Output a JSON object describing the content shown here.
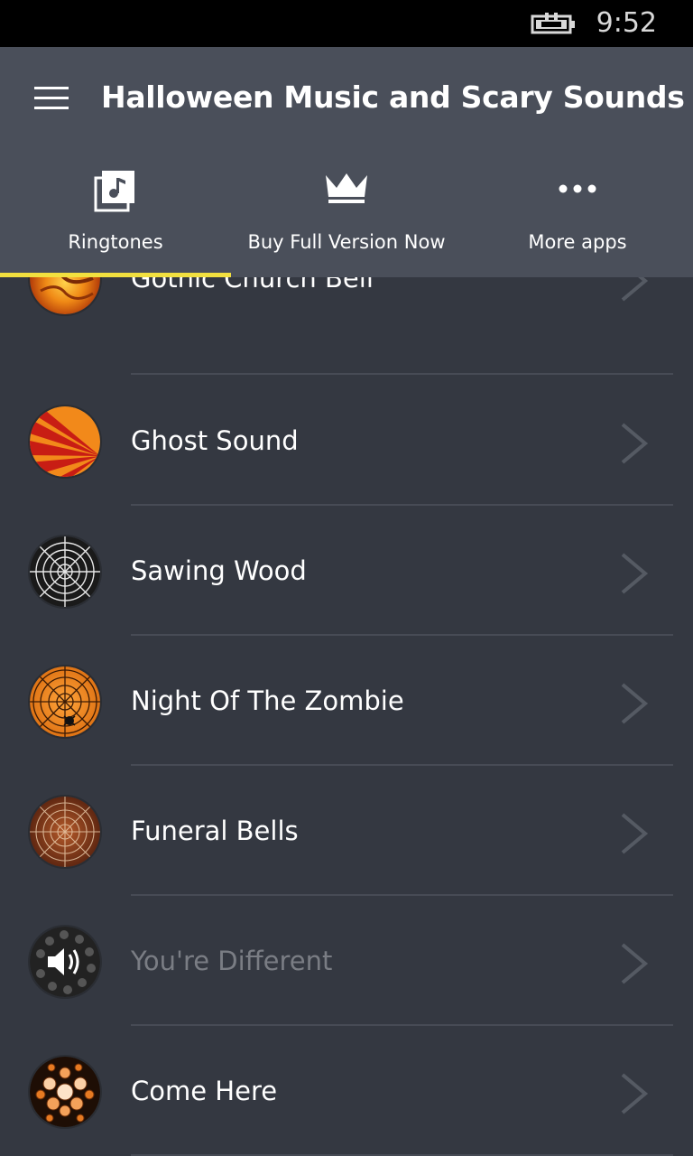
{
  "status": {
    "time": "9:52"
  },
  "header": {
    "title": "Halloween Music and Scary Sounds"
  },
  "tabs": [
    {
      "label": "Ringtones",
      "icon": "music-note-icon"
    },
    {
      "label": "Buy Full Version Now",
      "icon": "crown-icon"
    },
    {
      "label": "More apps",
      "icon": "more-dots-icon"
    }
  ],
  "items": [
    {
      "label": "Gothic Church Bell",
      "icon": "fire-orange-icon"
    },
    {
      "label": "Ghost Sound",
      "icon": "red-stripes-icon"
    },
    {
      "label": "Sawing Wood",
      "icon": "spider-web-grey-icon"
    },
    {
      "label": "Night Of The Zombie",
      "icon": "spider-web-orange-icon"
    },
    {
      "label": "Funeral Bells",
      "icon": "spider-web-brown-icon"
    },
    {
      "label": "You're Different",
      "icon": "speaker-playing-icon",
      "state": "playing"
    },
    {
      "label": "Come Here",
      "icon": "orange-bubbles-icon"
    }
  ],
  "colors": {
    "accent": "#f2e03f",
    "header": "#4a4f5a",
    "background": "#343841"
  }
}
